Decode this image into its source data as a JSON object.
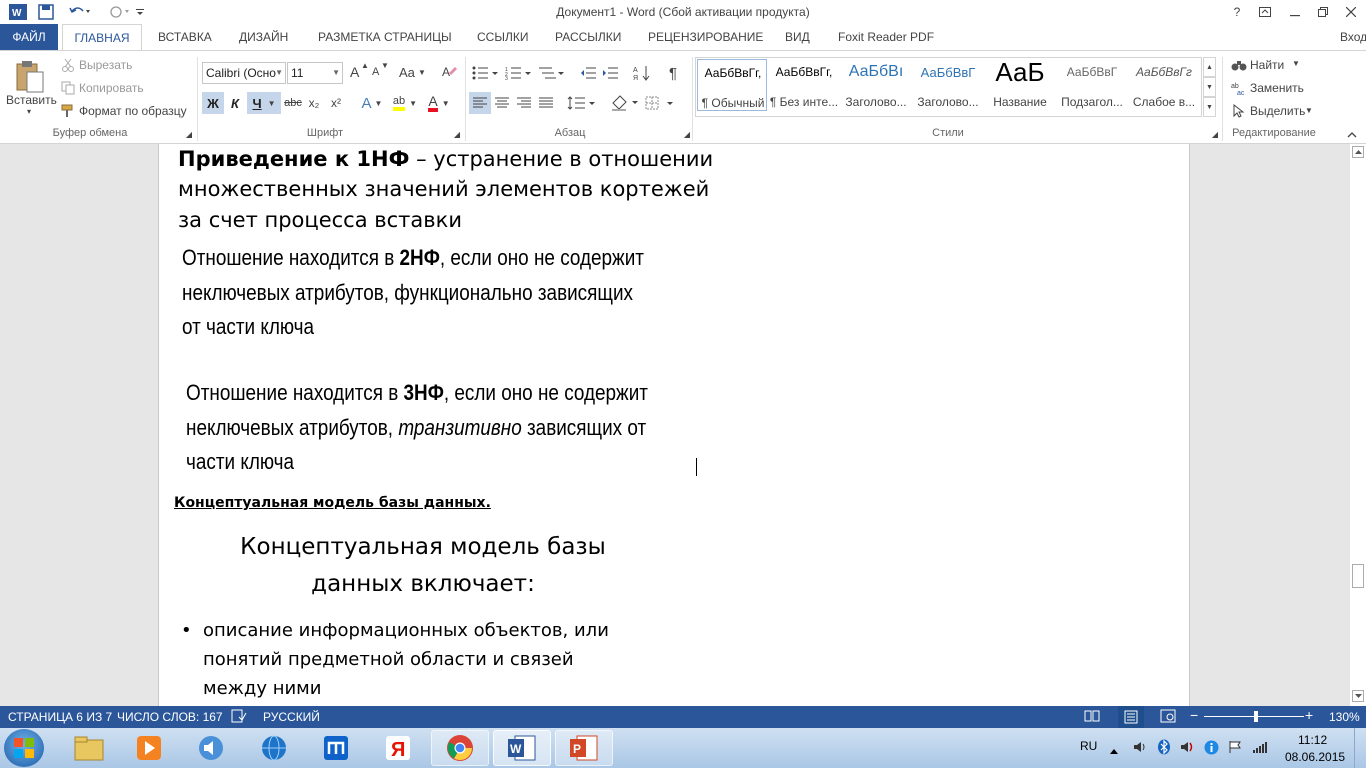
{
  "window": {
    "title": "Документ1 - Word (Сбой активации продукта)",
    "help": "?",
    "signin": "Вход"
  },
  "tabs": [
    {
      "label": "ФАЙЛ"
    },
    {
      "label": "ГЛАВНАЯ"
    },
    {
      "label": "ВСТАВКА"
    },
    {
      "label": "ДИЗАЙН"
    },
    {
      "label": "РАЗМЕТКА СТРАНИЦЫ"
    },
    {
      "label": "ССЫЛКИ"
    },
    {
      "label": "РАССЫЛКИ"
    },
    {
      "label": "РЕЦЕНЗИРОВАНИЕ"
    },
    {
      "label": "ВИД"
    },
    {
      "label": "Foxit Reader PDF"
    }
  ],
  "ribbon": {
    "clipboard": {
      "paste": "Вставить",
      "cut": "Вырезать",
      "copy": "Копировать",
      "format_painter": "Формат по образцу",
      "label": "Буфер обмена"
    },
    "font": {
      "font_name": "Calibri (Осно",
      "font_size": "11",
      "bold": "Ж",
      "italic": "К",
      "underline": "Ч",
      "strike": "abc",
      "subscript": "x₂",
      "superscript": "x²",
      "grow": "A",
      "shrink": "A",
      "case": "Aa",
      "effects": "A",
      "highlight": "ab",
      "color": "A",
      "label": "Шрифт"
    },
    "paragraph": {
      "pilcrow": "¶",
      "label": "Абзац"
    },
    "styles": {
      "items": [
        {
          "preview": "АаБбВвГг,",
          "name": "¶ Обычный"
        },
        {
          "preview": "АаБбВвГг,",
          "name": "¶ Без инте..."
        },
        {
          "preview": "АаБбВı",
          "name": "Заголово..."
        },
        {
          "preview": "АаБбВвГ",
          "name": "Заголово..."
        },
        {
          "preview": "АаБ",
          "name": "Название"
        },
        {
          "preview": "АаБбВвГ",
          "name": "Подзагол..."
        },
        {
          "preview": "АаБбВвГг",
          "name": "Слабое в..."
        }
      ],
      "label": "Стили"
    },
    "editing": {
      "find": "Найти",
      "replace": "Заменить",
      "select": "Выделить",
      "label": "Редактирование"
    }
  },
  "document": {
    "slide1": {
      "bold": "Приведение к 1НФ",
      "line1_rest": " – устранение в отношении",
      "line2": "множественных значений элементов кортежей",
      "line3": "за счет процесса вставки"
    },
    "slide2": {
      "pre": "Отношение находится в ",
      "bold": "2НФ",
      "line1_rest": ", если оно не содержит",
      "line2": "неключевых атрибутов, функционально зависящих",
      "line3": "от части ключа"
    },
    "slide3": {
      "pre": "Отношение находится в ",
      "bold": "3НФ",
      "line1_rest": ", если оно не содержит",
      "line2_pre": "неключевых атрибутов, ",
      "line2_italic": "транзитивно",
      "line2_rest": " зависящих от",
      "line3": "части ключа"
    },
    "heading": "Концептуальная модель базы данных.",
    "slide4": {
      "title_line1": "Концептуальная модель базы",
      "title_line2": "данных включает:",
      "bullet": "•",
      "item_line1": "описание информационных объектов, или",
      "item_line2": "понятий предметной области и связей",
      "item_line3": "между ними"
    }
  },
  "statusbar": {
    "page": "СТРАНИЦА 6 ИЗ 7",
    "words": "ЧИСЛО СЛОВ: 167",
    "language": "РУССКИЙ",
    "zoom": "130%"
  },
  "taskbar": {
    "lang": "RU",
    "time": "11:12",
    "date": "08.06.2015"
  }
}
